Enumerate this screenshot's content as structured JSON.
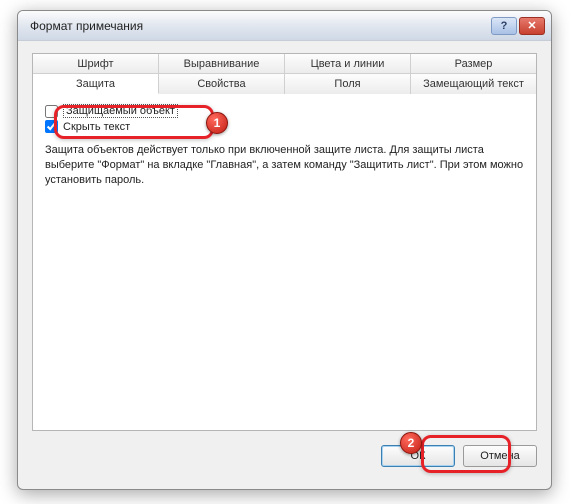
{
  "window": {
    "title": "Формат примечания",
    "help_symbol": "?",
    "close_symbol": "✕"
  },
  "tabs_row1": [
    {
      "label": "Шрифт"
    },
    {
      "label": "Выравнивание"
    },
    {
      "label": "Цвета и линии"
    },
    {
      "label": "Размер"
    }
  ],
  "tabs_row2": [
    {
      "label": "Защита"
    },
    {
      "label": "Свойства"
    },
    {
      "label": "Поля"
    },
    {
      "label": "Замещающий текст"
    }
  ],
  "protection": {
    "checkbox1_label": "Защищаемый объект",
    "checkbox1_checked": false,
    "checkbox2_label": "Скрыть текст",
    "checkbox2_checked": true,
    "help_text": "Защита объектов действует только при включенной защите листа. Для защиты листа выберите \"Формат\" на вкладке \"Главная\", а затем команду \"Защитить лист\". При этом можно установить пароль."
  },
  "buttons": {
    "ok": "ОК",
    "cancel": "Отмена"
  },
  "annotations": {
    "num1": "1",
    "num2": "2"
  }
}
